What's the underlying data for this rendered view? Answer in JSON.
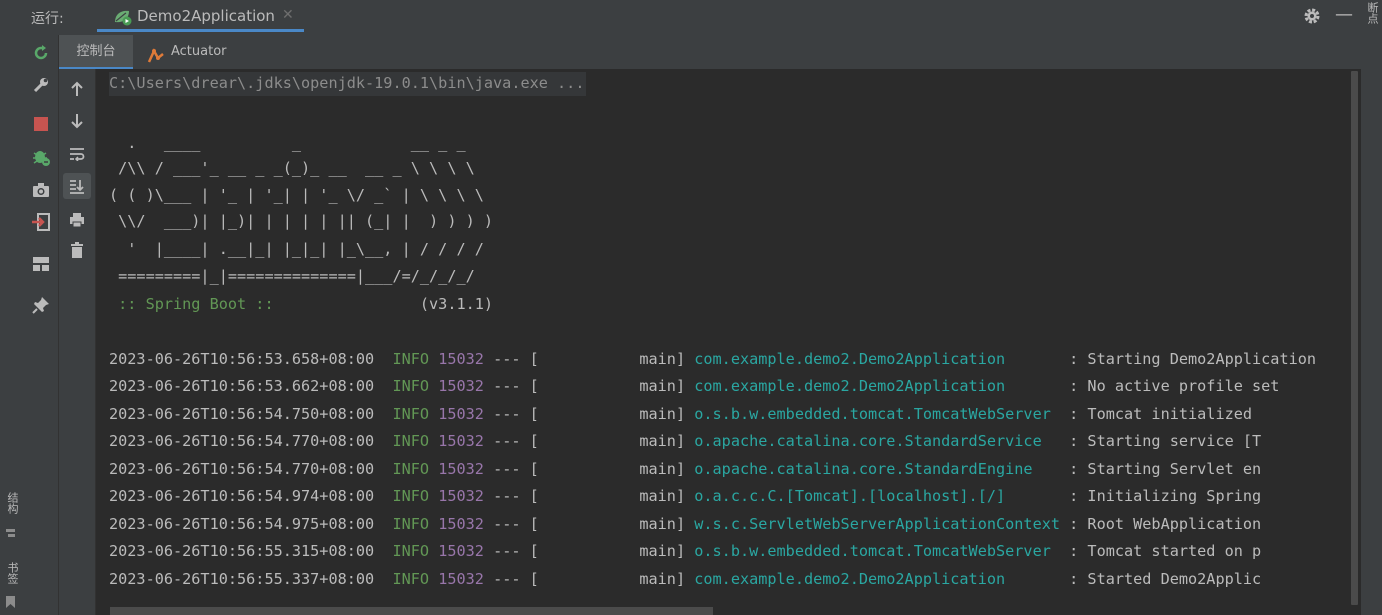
{
  "right_strip": {
    "label": "断点"
  },
  "left_strip": {
    "structure_label": "结构",
    "bookmarks_label": "书签"
  },
  "topbar": {
    "run_label": "运行:",
    "tab_name": "Demo2Application"
  },
  "subtabs": [
    {
      "label": "控制台"
    },
    {
      "label": "Actuator"
    }
  ],
  "console": {
    "command": "C:\\Users\\drear\\.jdks\\openjdk-19.0.1\\bin\\java.exe ...",
    "banner": [
      "  .   ____          _            __ _ _",
      " /\\\\ / ___'_ __ _ _(_)_ __  __ _ \\ \\ \\ \\",
      "( ( )\\___ | '_ | '_| | '_ \\/ _` | \\ \\ \\ \\",
      " \\\\/  ___)| |_)| | | | | || (_| |  ) ) ) )",
      "  '  |____| .__|_| |_|_| |_\\__, | / / / /",
      " =========|_|==============|___/=/_/_/_/"
    ],
    "spring_label": " :: Spring Boot :: ",
    "spring_version": "               (v3.1.1)",
    "logs": [
      {
        "ts": "2023-06-26T10:56:53.658+08:00",
        "level": "INFO",
        "pid": "15032",
        "sep": " --- [",
        "thread": "           main] ",
        "logger": "com.example.demo2.Demo2Application      ",
        "msg": " : Starting Demo2Application"
      },
      {
        "ts": "2023-06-26T10:56:53.662+08:00",
        "level": "INFO",
        "pid": "15032",
        "sep": " --- [",
        "thread": "           main] ",
        "logger": "com.example.demo2.Demo2Application      ",
        "msg": " : No active profile set"
      },
      {
        "ts": "2023-06-26T10:56:54.750+08:00",
        "level": "INFO",
        "pid": "15032",
        "sep": " --- [",
        "thread": "           main] ",
        "logger": "o.s.b.w.embedded.tomcat.TomcatWebServer ",
        "msg": " : Tomcat initialized"
      },
      {
        "ts": "2023-06-26T10:56:54.770+08:00",
        "level": "INFO",
        "pid": "15032",
        "sep": " --- [",
        "thread": "           main] ",
        "logger": "o.apache.catalina.core.StandardService  ",
        "msg": " : Starting service [T"
      },
      {
        "ts": "2023-06-26T10:56:54.770+08:00",
        "level": "INFO",
        "pid": "15032",
        "sep": " --- [",
        "thread": "           main] ",
        "logger": "o.apache.catalina.core.StandardEngine   ",
        "msg": " : Starting Servlet en"
      },
      {
        "ts": "2023-06-26T10:56:54.974+08:00",
        "level": "INFO",
        "pid": "15032",
        "sep": " --- [",
        "thread": "           main] ",
        "logger": "o.a.c.c.C.[Tomcat].[localhost].[/]      ",
        "msg": " : Initializing Spring"
      },
      {
        "ts": "2023-06-26T10:56:54.975+08:00",
        "level": "INFO",
        "pid": "15032",
        "sep": " --- [",
        "thread": "           main] ",
        "logger": "w.s.c.ServletWebServerApplicationContext",
        "msg": " : Root WebApplication"
      },
      {
        "ts": "2023-06-26T10:56:55.315+08:00",
        "level": "INFO",
        "pid": "15032",
        "sep": " --- [",
        "thread": "           main] ",
        "logger": "o.s.b.w.embedded.tomcat.TomcatWebServer ",
        "msg": " : Tomcat started on p"
      },
      {
        "ts": "2023-06-26T10:56:55.337+08:00",
        "level": "INFO",
        "pid": "15032",
        "sep": " --- [",
        "thread": "           main] ",
        "logger": "com.example.demo2.Demo2Application      ",
        "msg": " : Started Demo2Applic"
      }
    ]
  }
}
